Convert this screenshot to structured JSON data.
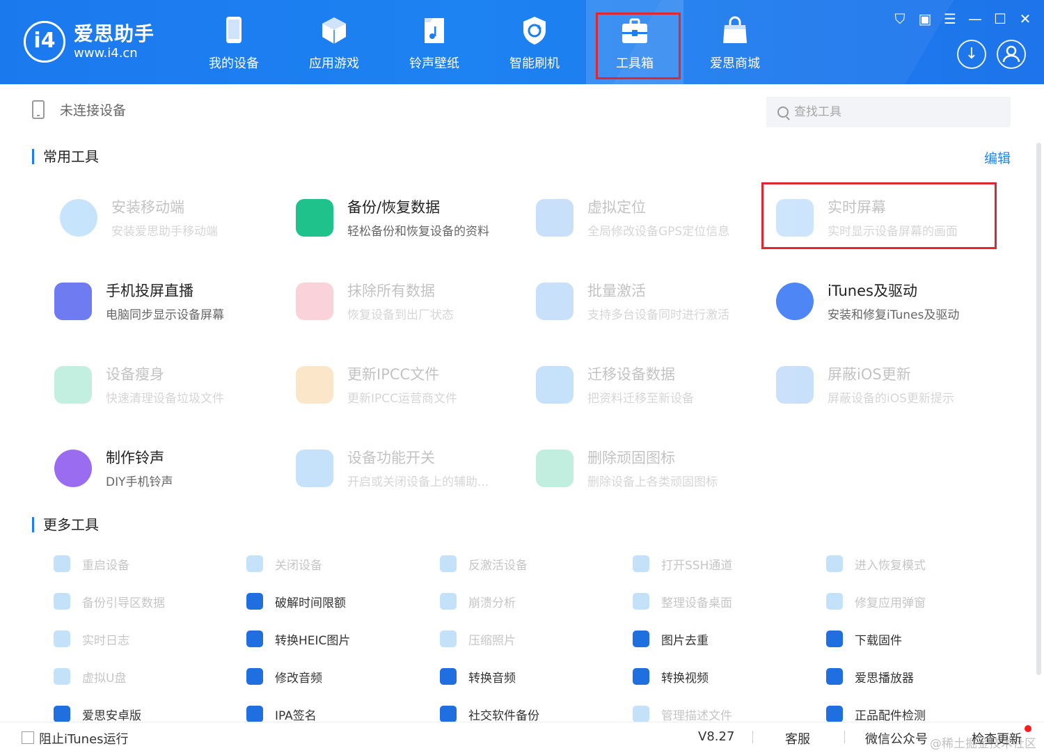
{
  "app": {
    "brand_name": "爱思助手",
    "brand_url": "www.i4.cn",
    "logo_text": "i4"
  },
  "nav": [
    {
      "label": "我的设备",
      "icon": "phone-icon"
    },
    {
      "label": "应用游戏",
      "icon": "cube-icon"
    },
    {
      "label": "铃声壁纸",
      "icon": "music-file-icon"
    },
    {
      "label": "智能刷机",
      "icon": "refresh-shield-icon"
    },
    {
      "label": "工具箱",
      "icon": "toolbox-icon",
      "active": true
    },
    {
      "label": "爱思商城",
      "icon": "shopping-bag-icon"
    }
  ],
  "device_status": "未连接设备",
  "search": {
    "placeholder": "查找工具"
  },
  "common_tools": {
    "title": "常用工具",
    "edit_label": "编辑",
    "items": [
      {
        "title": "安装移动端",
        "desc": "安装爱思助手移动端",
        "enabled": false,
        "color": "#2b9bf0"
      },
      {
        "title": "备份/恢复数据",
        "desc": "轻松备份和恢复设备的资料",
        "enabled": true,
        "color": "#1fc28b"
      },
      {
        "title": "虚拟定位",
        "desc": "全局修改设备GPS定位信息",
        "enabled": false,
        "color": "#3d8ff2"
      },
      {
        "title": "实时屏幕",
        "desc": "实时显示设备屏幕的画面",
        "enabled": false,
        "color": "#4aa3f5"
      },
      {
        "title": "手机投屏直播",
        "desc": "电脑同步显示设备屏幕",
        "enabled": true,
        "color": "#6f7bf0"
      },
      {
        "title": "抹除所有数据",
        "desc": "恢复设备到出厂状态",
        "enabled": false,
        "color": "#f05b7a"
      },
      {
        "title": "批量激活",
        "desc": "支持多台设备同时进行激活",
        "enabled": false,
        "color": "#3c90f2"
      },
      {
        "title": "iTunes及驱动",
        "desc": "安装和修复iTunes及驱动",
        "enabled": true,
        "color": "#4e86f5"
      },
      {
        "title": "设备瘦身",
        "desc": "快速清理设备垃圾文件",
        "enabled": false,
        "color": "#21c58f"
      },
      {
        "title": "更新IPCC文件",
        "desc": "更新IPCC运营商文件",
        "enabled": false,
        "color": "#f6a53a"
      },
      {
        "title": "迁移设备数据",
        "desc": "把资料迁移至新设备",
        "enabled": false,
        "color": "#2f95ef"
      },
      {
        "title": "屏蔽iOS更新",
        "desc": "屏蔽设备的iOS更新提示",
        "enabled": false,
        "color": "#3b8ef2"
      },
      {
        "title": "制作铃声",
        "desc": "DIY手机铃声",
        "enabled": true,
        "color": "#9a6cf0"
      },
      {
        "title": "设备功能开关",
        "desc": "开启或关闭设备上的辅助...",
        "enabled": false,
        "color": "#2f95ef"
      },
      {
        "title": "删除顽固图标",
        "desc": "删除设备上各类顽固图标",
        "enabled": false,
        "color": "#22c28c"
      }
    ]
  },
  "more_tools": {
    "title": "更多工具",
    "items": [
      {
        "label": "重启设备",
        "enabled": false,
        "color": "#2b9bf0"
      },
      {
        "label": "关闭设备",
        "enabled": false,
        "color": "#2b9bf0"
      },
      {
        "label": "反激活设备",
        "enabled": false,
        "color": "#2b9bf0"
      },
      {
        "label": "打开SSH通道",
        "enabled": false,
        "color": "#2b9bf0"
      },
      {
        "label": "进入恢复模式",
        "enabled": false,
        "color": "#2b9bf0"
      },
      {
        "label": "备份引导区数据",
        "enabled": false,
        "color": "#2b9bf0"
      },
      {
        "label": "破解时间限额",
        "enabled": true,
        "color": "#1f6fe0"
      },
      {
        "label": "崩溃分析",
        "enabled": false,
        "color": "#2b9bf0"
      },
      {
        "label": "整理设备桌面",
        "enabled": false,
        "color": "#2b9bf0"
      },
      {
        "label": "修复应用弹窗",
        "enabled": false,
        "color": "#2b9bf0"
      },
      {
        "label": "实时日志",
        "enabled": false,
        "color": "#2b9bf0"
      },
      {
        "label": "转换HEIC图片",
        "enabled": true,
        "color": "#1f6fe0"
      },
      {
        "label": "压缩照片",
        "enabled": false,
        "color": "#2b9bf0"
      },
      {
        "label": "图片去重",
        "enabled": true,
        "color": "#1f6fe0"
      },
      {
        "label": "下载固件",
        "enabled": true,
        "color": "#1f6fe0"
      },
      {
        "label": "虚拟U盘",
        "enabled": false,
        "color": "#2b9bf0"
      },
      {
        "label": "修改音频",
        "enabled": true,
        "color": "#1f6fe0"
      },
      {
        "label": "转换音频",
        "enabled": true,
        "color": "#1f6fe0"
      },
      {
        "label": "转换视频",
        "enabled": true,
        "color": "#1f6fe0"
      },
      {
        "label": "爱思播放器",
        "enabled": true,
        "color": "#1f6fe0"
      },
      {
        "label": "爱思安卓版",
        "enabled": true,
        "color": "#1f6fe0"
      },
      {
        "label": "IPA签名",
        "enabled": true,
        "color": "#1f6fe0"
      },
      {
        "label": "社交软件备份",
        "enabled": true,
        "color": "#1f6fe0"
      },
      {
        "label": "管理描述文件",
        "enabled": false,
        "color": "#2b9bf0"
      },
      {
        "label": "正品配件检测",
        "enabled": true,
        "color": "#1f6fe0"
      }
    ]
  },
  "status_bar": {
    "block_itunes": "阻止iTunes运行",
    "version": "V8.27",
    "service": "客服",
    "wechat": "微信公众号",
    "check_update": "检查更新",
    "watermark": "@稀土掘金技术社区"
  },
  "colors": {
    "accent": "#1d7ef0",
    "highlight": "#e0262f"
  }
}
